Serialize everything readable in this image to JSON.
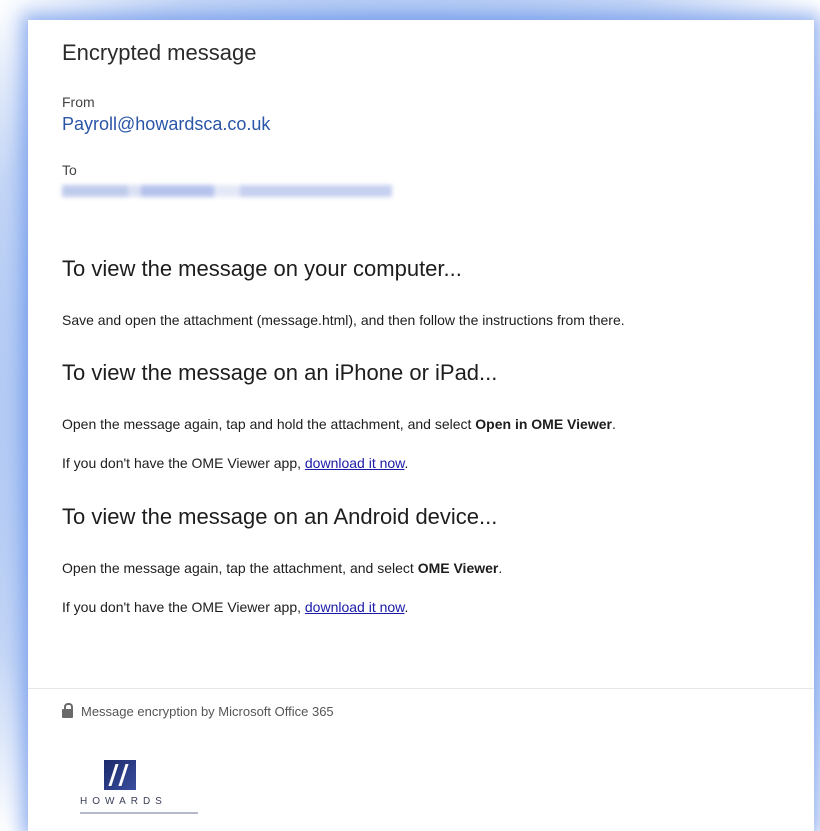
{
  "email": {
    "title": "Encrypted message",
    "from_label": "From",
    "from_address": "Payroll@howardsca.co.uk",
    "to_label": "To"
  },
  "sections": [
    {
      "heading": "To view the message on your computer...",
      "line1": "Save and open the attachment (message.html), and then follow the instructions from there."
    },
    {
      "heading": "To view the message on an iPhone or iPad...",
      "line1_pre": "Open the message again, tap and hold the attachment, and select ",
      "line1_bold": "Open in OME Viewer",
      "line1_post": ".",
      "line2_pre": "If you don't have the OME Viewer app, ",
      "line2_link": "download it now",
      "line2_post": "."
    },
    {
      "heading": "To view the message on an Android device...",
      "line1_pre": "Open the message again, tap the attachment, and select ",
      "line1_bold": "OME Viewer",
      "line1_post": ".",
      "line2_pre": "If you don't have the OME Viewer app, ",
      "line2_link": "download it now",
      "line2_post": "."
    }
  ],
  "footer": {
    "text": "Message encryption by Microsoft Office 365",
    "icon": "lock-icon"
  },
  "logo": {
    "text": "HOWARDS"
  },
  "colors": {
    "link": "#1a1aa8",
    "from_address": "#2a55a8",
    "glow": "#9fbdf2"
  }
}
